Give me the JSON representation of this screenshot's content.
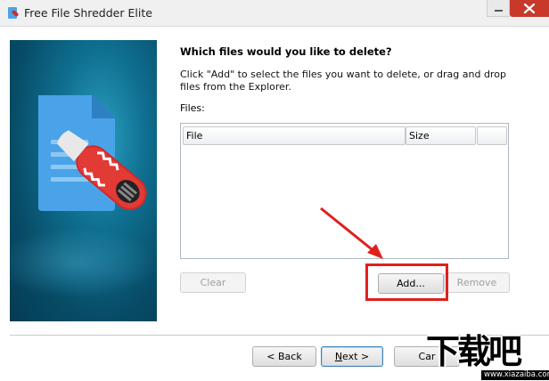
{
  "window": {
    "title": "Free File Shredder Elite",
    "close_color": "#c8392b"
  },
  "wizard": {
    "heading": "Which files would you like to delete?",
    "instruction": "Click \"Add\" to select the files you want to delete, or drag and drop files from the Explorer.",
    "files_label": "Files:",
    "columns": [
      "File",
      "Size",
      ""
    ]
  },
  "buttons": {
    "clear": "Clear",
    "add": "Add...",
    "remove": "Remove",
    "back": "< Back",
    "next_underlined": "N",
    "next_rest": "ext >",
    "cancel": "Car"
  },
  "watermark": {
    "text": "下载吧",
    "url": "www.xiazaiba.com"
  },
  "colors": {
    "banner": "#0f6f90",
    "highlight": "#e0201c",
    "icon_document": "#4aa3e8",
    "icon_shredder": "#d02a2a"
  },
  "icons": [
    "app-shredder-icon",
    "document-shredder-icon",
    "arrow-annotation-icon"
  ]
}
